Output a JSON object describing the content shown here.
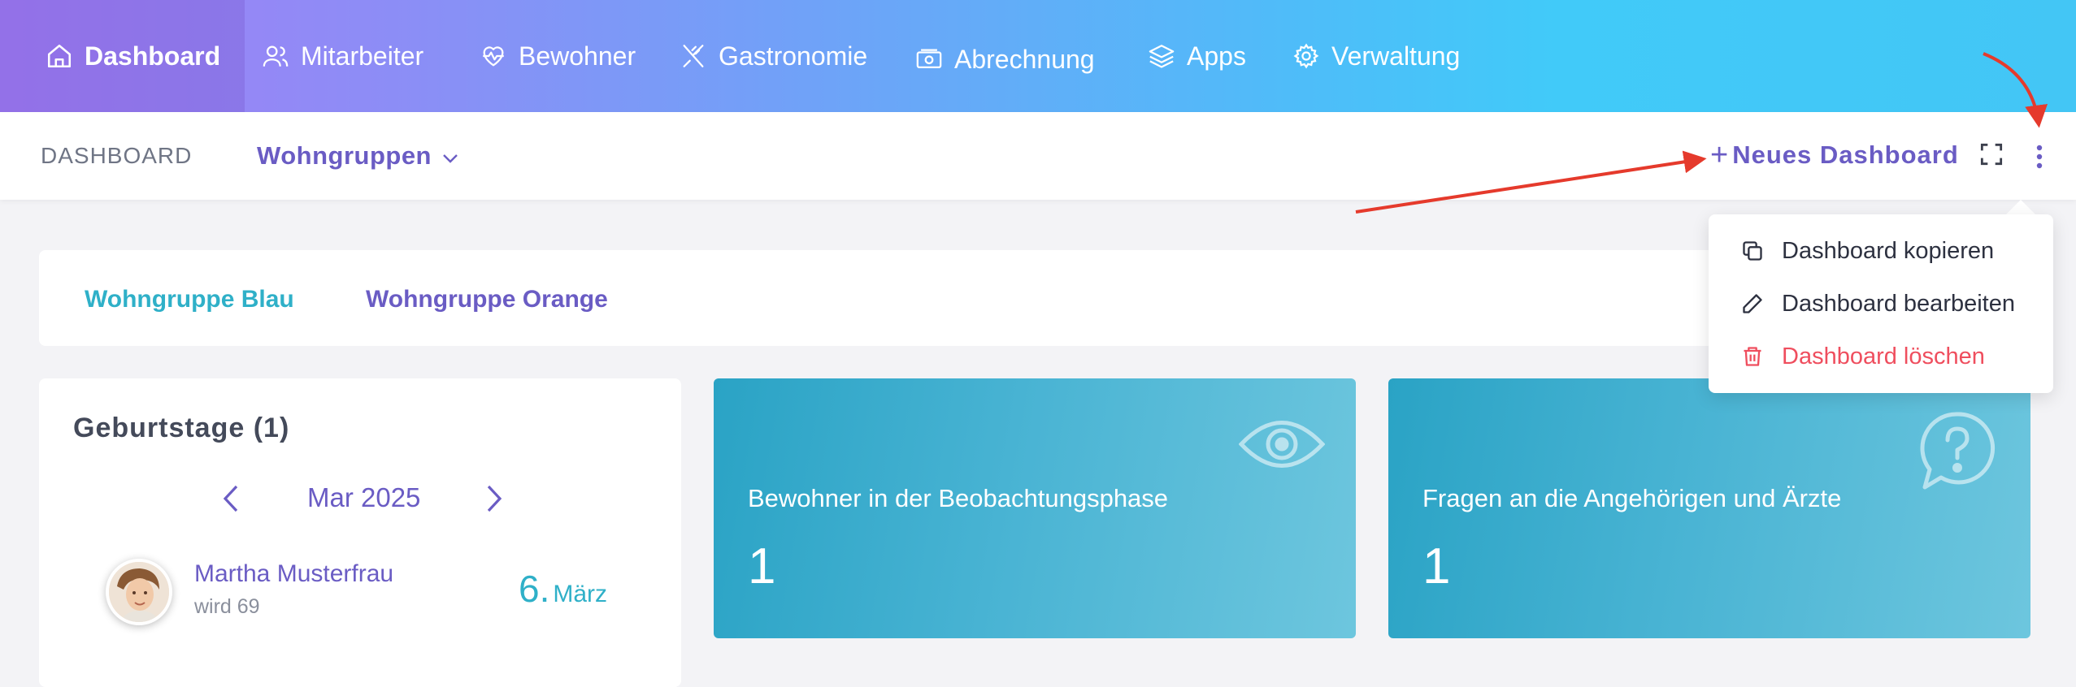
{
  "colors": {
    "accent": "#6a5cc4",
    "teal": "#2fb0c8",
    "danger": "#ef4e5e",
    "card_gradient_start": "#2aa3c5",
    "card_gradient_end": "#6dc6de",
    "annotation_arrow": "#e53a2c"
  },
  "nav": {
    "items": [
      {
        "label": "Dashboard",
        "icon": "home-icon",
        "active": true
      },
      {
        "label": "Mitarbeiter",
        "icon": "users-icon"
      },
      {
        "label": "Bewohner",
        "icon": "heart-pulse-icon"
      },
      {
        "label": "Gastronomie",
        "icon": "utensils-icon"
      },
      {
        "label": "Abrechnung",
        "icon": "money-icon"
      },
      {
        "label": "Apps",
        "icon": "layers-icon"
      },
      {
        "label": "Verwaltung",
        "icon": "gear-icon"
      }
    ]
  },
  "subheader": {
    "title": "DASHBOARD",
    "group_select": "Wohngruppen",
    "new_dashboard_plus": "+",
    "new_dashboard": "Neues Dashboard"
  },
  "tabs": [
    "Wohngruppe Blau",
    "Wohngruppe Orange"
  ],
  "birthdays": {
    "title": "Geburtstage (1)",
    "month": "Mar 2025",
    "entries": [
      {
        "name": "Martha Musterfrau",
        "sub": "wird 69",
        "day": "6.",
        "month": "März"
      }
    ]
  },
  "stat_cards": [
    {
      "title": "Bewohner in der Beobachtungsphase",
      "value": "1",
      "icon": "eye-icon"
    },
    {
      "title": "Fragen an die Angehörigen und Ärzte",
      "value": "1",
      "icon": "question-bubble-icon"
    }
  ],
  "dropdown": {
    "items": [
      {
        "label": "Dashboard kopieren",
        "icon": "copy-icon"
      },
      {
        "label": "Dashboard bearbeiten",
        "icon": "pencil-icon"
      },
      {
        "label": "Dashboard löschen",
        "icon": "trash-icon",
        "danger": true
      }
    ]
  }
}
